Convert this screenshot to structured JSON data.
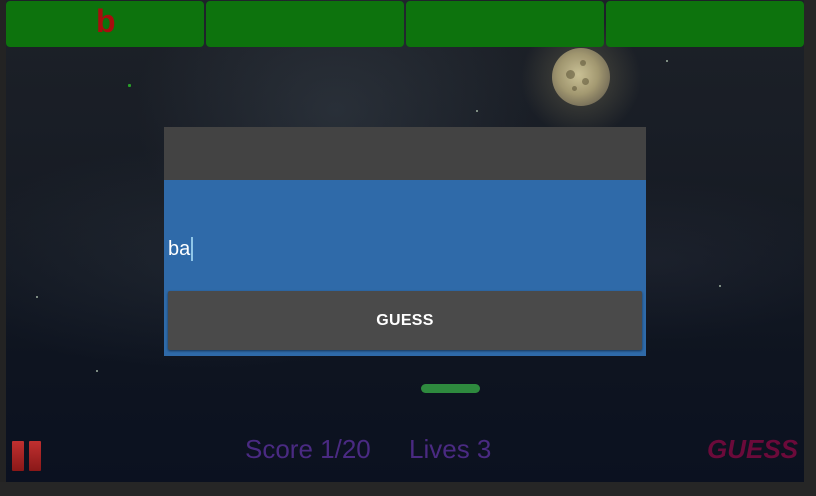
{
  "letter_slots": [
    {
      "letter": "b"
    },
    {
      "letter": ""
    },
    {
      "letter": ""
    },
    {
      "letter": ""
    }
  ],
  "dialog": {
    "input_value": "ba",
    "guess_button_label": "GUESS"
  },
  "hud": {
    "score": "Score 1/20",
    "lives": "Lives 3",
    "guess_button_label": "GUESS"
  },
  "icons": {
    "pause": "pause-icon"
  },
  "colors": {
    "slot_green": "#0d730d",
    "slot_letter_red": "#a80d0d",
    "dialog_blue": "#2f6aa9",
    "hud_purple": "#4a2a82",
    "hud_guess_magenta": "#6b0a3a",
    "paddle_green": "#2e8a3e"
  }
}
